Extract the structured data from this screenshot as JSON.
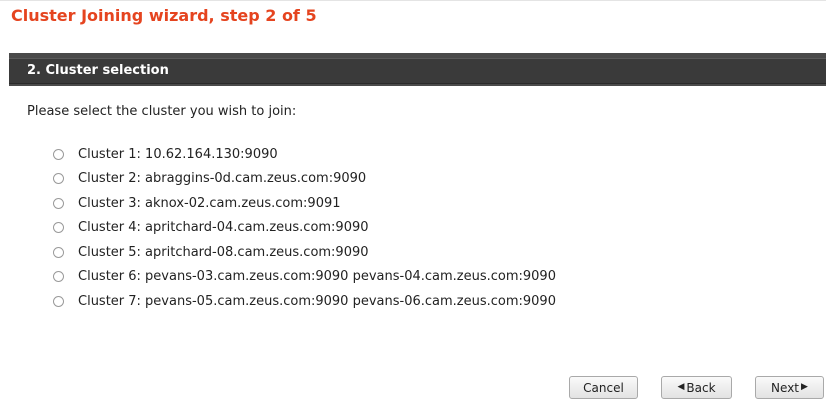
{
  "wizard": {
    "title": "Cluster Joining wizard, step 2 of 5"
  },
  "section": {
    "title": "2. Cluster selection",
    "prompt": "Please select the cluster you wish to join:"
  },
  "clusters": [
    {
      "label": "Cluster 1: 10.62.164.130:9090"
    },
    {
      "label": "Cluster 2: abraggins-0d.cam.zeus.com:9090"
    },
    {
      "label": "Cluster 3: aknox-02.cam.zeus.com:9091"
    },
    {
      "label": "Cluster 4: apritchard-04.cam.zeus.com:9090"
    },
    {
      "label": "Cluster 5: apritchard-08.cam.zeus.com:9090"
    },
    {
      "label": "Cluster 6: pevans-03.cam.zeus.com:9090 pevans-04.cam.zeus.com:9090"
    },
    {
      "label": "Cluster 7: pevans-05.cam.zeus.com:9090 pevans-06.cam.zeus.com:9090"
    }
  ],
  "buttons": {
    "cancel": "Cancel",
    "back": "Back",
    "next": "Next"
  },
  "icons": {
    "back": "left-triangle-icon",
    "next": "right-triangle-icon"
  },
  "colors": {
    "title": "#e5441f",
    "header_bg": "#3a3a3a"
  }
}
